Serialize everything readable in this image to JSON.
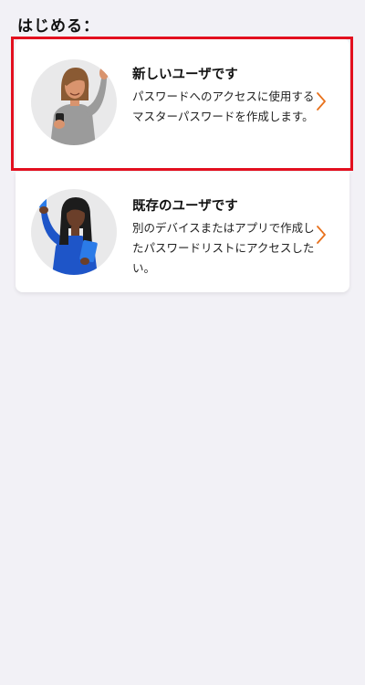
{
  "heading": "はじめる：",
  "options": [
    {
      "title": "新しいユーザです",
      "description": "パスワードへのアクセスに使用するマスターパスワードを作成します。",
      "illustration": "waving-person-with-phone-illustration"
    },
    {
      "title": "既存のユーザです",
      "description": "別のデバイスまたはアプリで作成したパスワードリストにアクセスしたい。",
      "illustration": "person-holding-phone-and-tablet-illustration"
    }
  ],
  "colors": {
    "background": "#f2f1f6",
    "card": "#ffffff",
    "accent_chevron": "#e8711c",
    "highlight": "#e3101f"
  },
  "icons": {
    "chevron": "chevron-right-icon"
  }
}
